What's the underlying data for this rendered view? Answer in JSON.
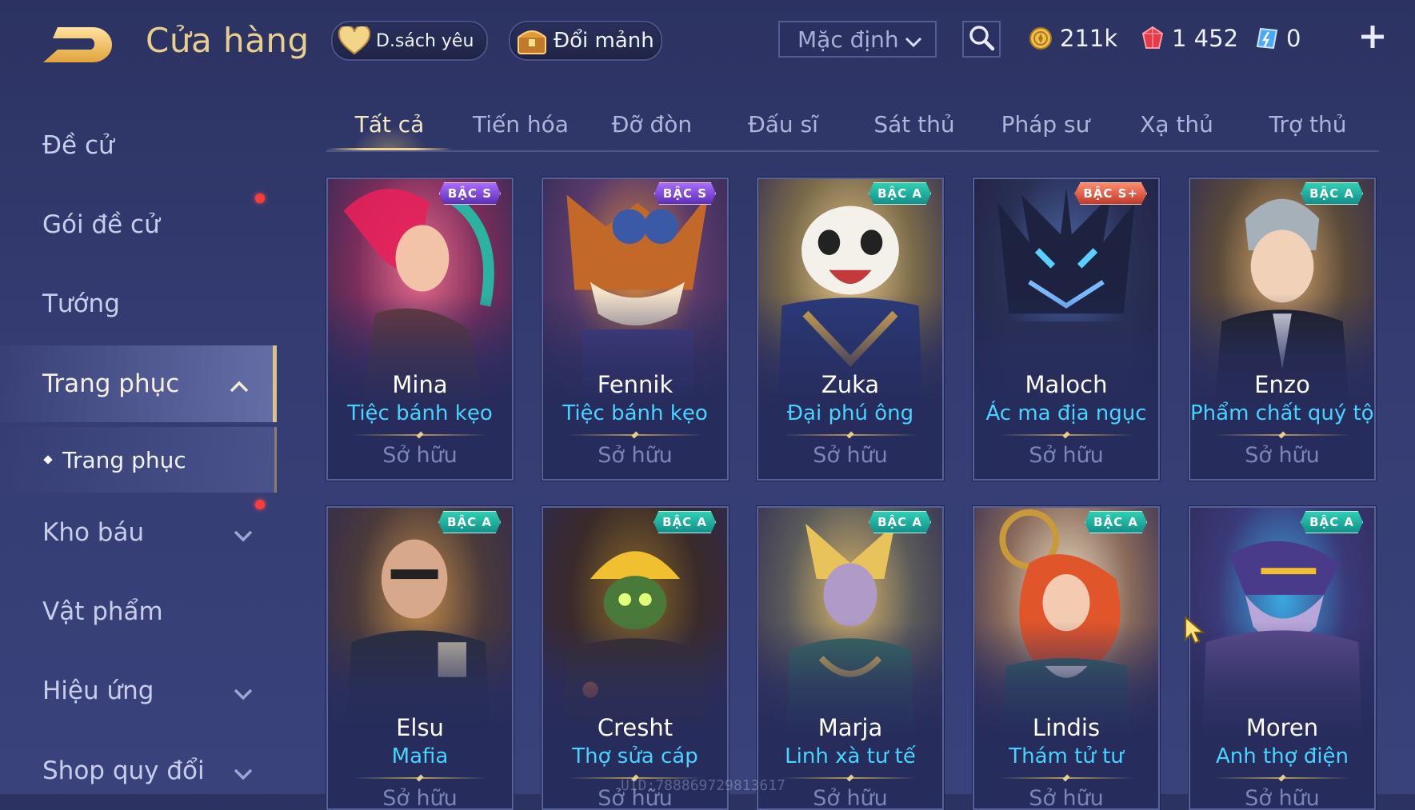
{
  "header": {
    "title": "Cửa hàng",
    "wishlist_label": "D.sách yêu",
    "shard_label": "Đổi mảnh",
    "sort_selected": "Mặc định",
    "currencies": [
      {
        "icon": "gold-coin-icon",
        "value": "211k"
      },
      {
        "icon": "ruby-gem-icon",
        "value": "1 452"
      },
      {
        "icon": "voucher-icon",
        "value": "0"
      }
    ]
  },
  "sidebar": {
    "items": [
      {
        "label": "Đề cử"
      },
      {
        "label": "Gói đề cử"
      },
      {
        "label": "Tướng"
      },
      {
        "label": "Trang phục"
      },
      {
        "label": "Kho báu"
      },
      {
        "label": "Vật phẩm"
      },
      {
        "label": "Hiệu ứng"
      },
      {
        "label": "Shop quy đổi"
      }
    ],
    "sub_item": "Trang phục",
    "active": "Trang phục"
  },
  "tabs": [
    "Tất cả",
    "Tiến hóa",
    "Đỡ đòn",
    "Đấu sĩ",
    "Sát thủ",
    "Pháp sư",
    "Xạ thủ",
    "Trợ thủ"
  ],
  "active_tab": "Tất cả",
  "skins": [
    {
      "hero": "Mina",
      "skin": "Tiệc bánh kẹo",
      "tier": "BẬC S",
      "status": "Sở hữu"
    },
    {
      "hero": "Fennik",
      "skin": "Tiệc bánh kẹo",
      "tier": "BẬC S",
      "status": "Sở hữu"
    },
    {
      "hero": "Zuka",
      "skin": "Đại phú ông",
      "tier": "BẬC A",
      "status": "Sở hữu"
    },
    {
      "hero": "Maloch",
      "skin": "Ác ma địa ngục",
      "tier": "BẬC S+",
      "status": "Sở hữu"
    },
    {
      "hero": "Enzo",
      "skin": "Phẩm chất quý tộc",
      "tier": "BẬC A",
      "status": "Sở hữu"
    },
    {
      "hero": "Elsu",
      "skin": "Mafia",
      "tier": "BẬC A",
      "status": "Sở hữu"
    },
    {
      "hero": "Cresht",
      "skin": "Thợ sửa cáp",
      "tier": "BẬC A",
      "status": "Sở hữu"
    },
    {
      "hero": "Marja",
      "skin": "Linh xà tư tế",
      "tier": "BẬC A",
      "status": "Sở hữu"
    },
    {
      "hero": "Lindis",
      "skin": "Thám tử tư",
      "tier": "BẬC A",
      "status": "Sở hữu"
    },
    {
      "hero": "Moren",
      "skin": "Anh thợ điện",
      "tier": "BẬC A",
      "status": "Sở hữu"
    }
  ],
  "uid_watermark": "UID:788869729813617",
  "colors": {
    "background": "#343c72",
    "title_gold": "#e9cf8c",
    "skin_name_cyan": "#49d4ff",
    "badge_a": "#1fb3a0",
    "badge_s": "#7b45d9",
    "badge_splus": "#e0553f",
    "notification_red": "#ff3a3a"
  }
}
